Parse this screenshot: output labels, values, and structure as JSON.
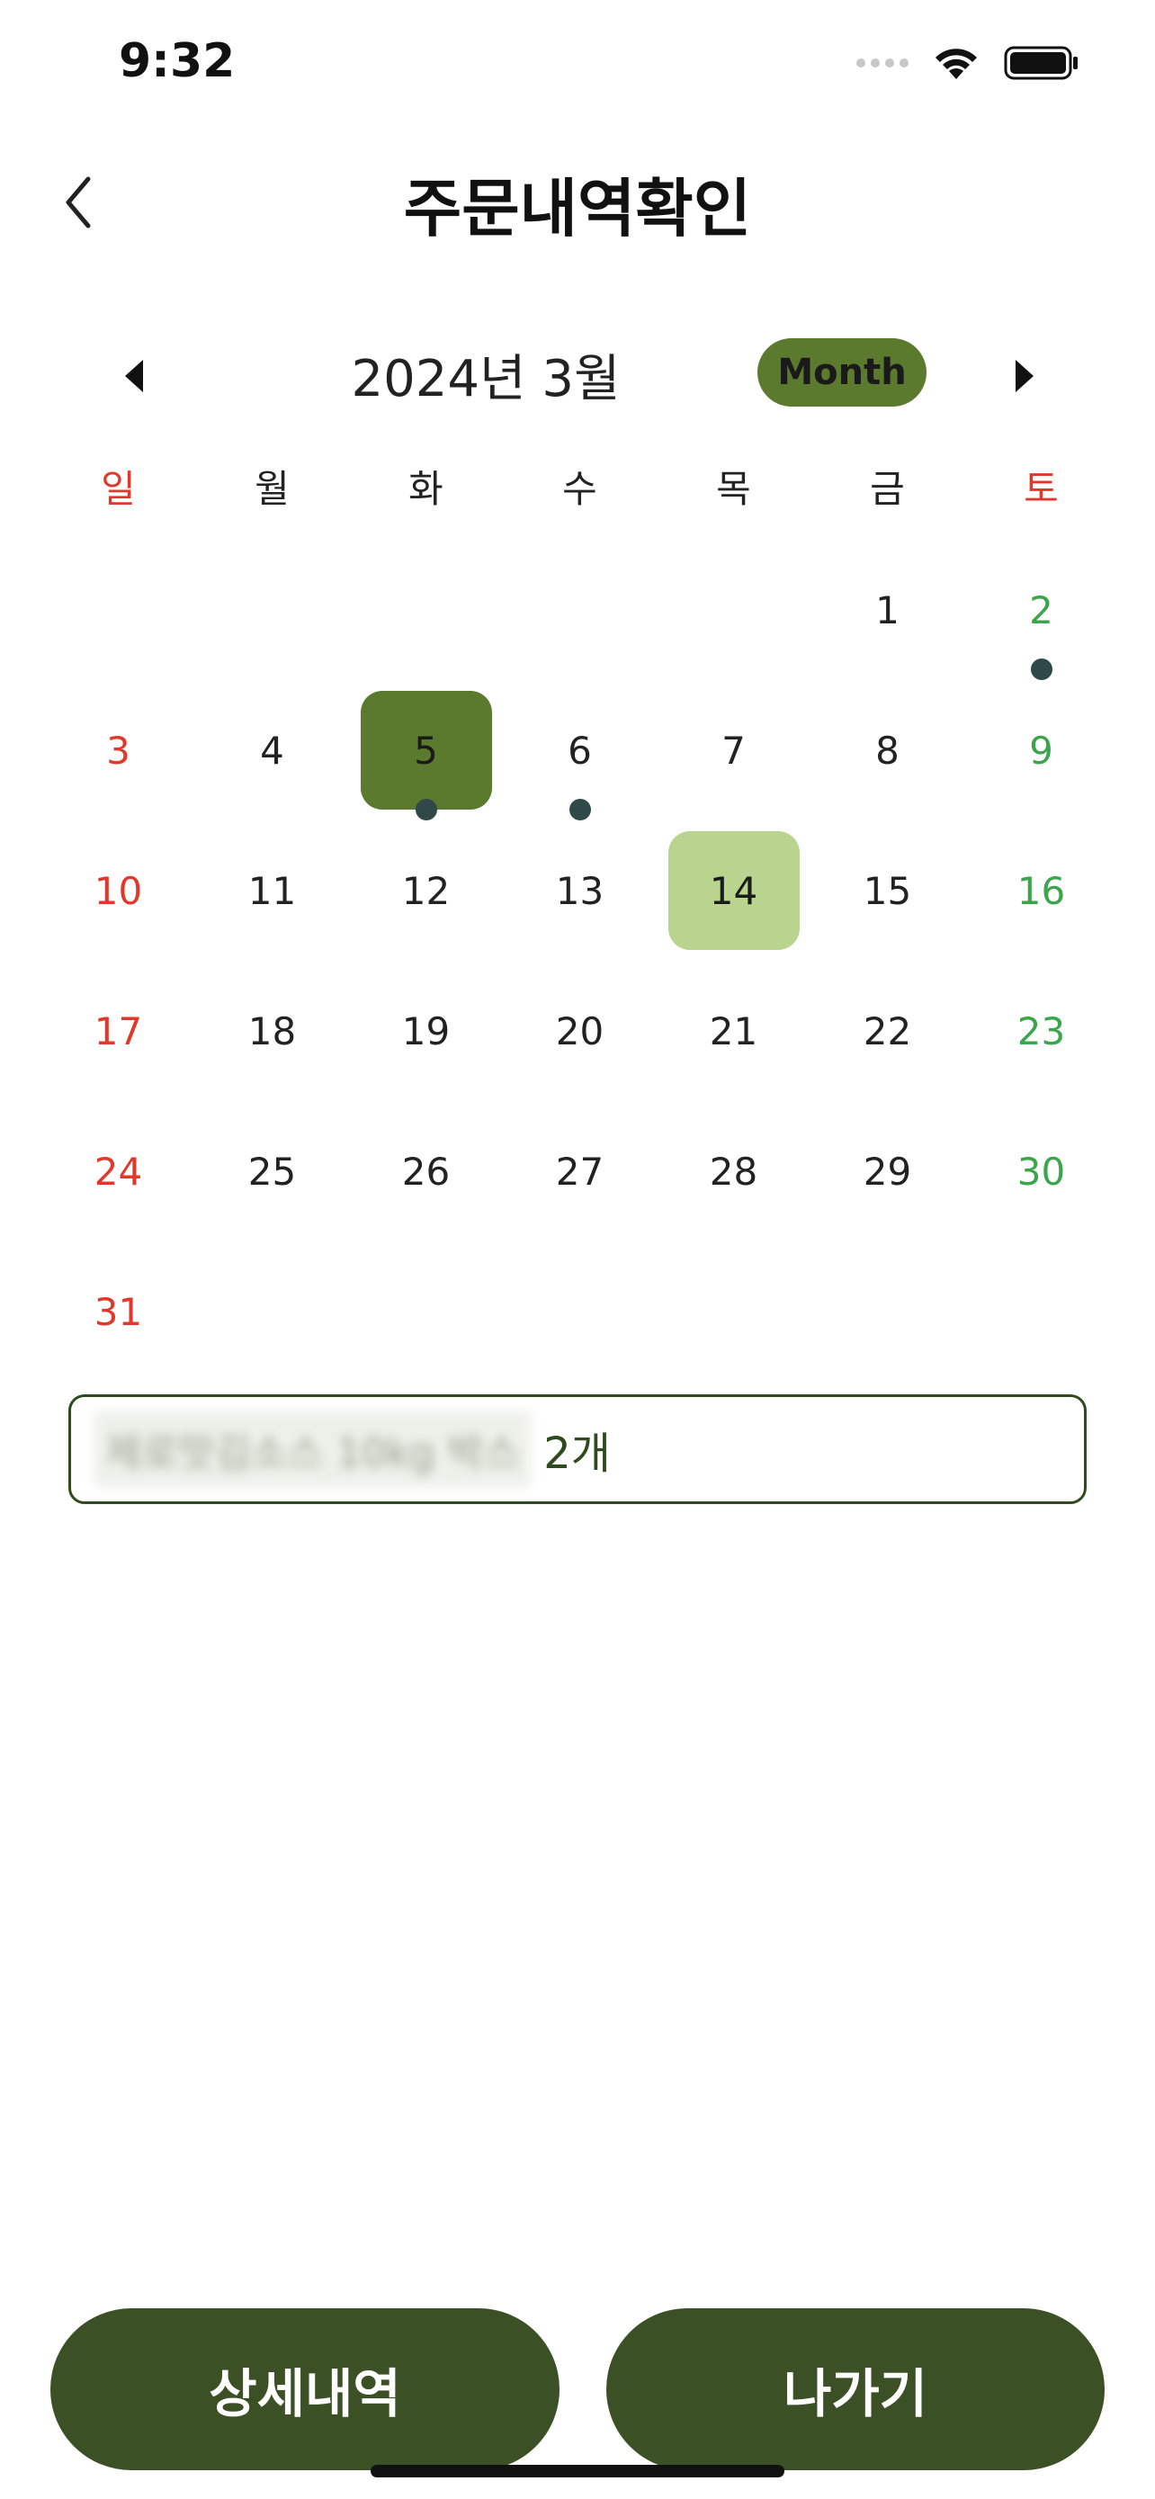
{
  "status_bar": {
    "time": "9:32"
  },
  "header": {
    "title": "주문내역확인"
  },
  "calendar": {
    "month_label": "2024년 3월",
    "view_toggle": "Month",
    "weekdays": [
      "일",
      "월",
      "화",
      "수",
      "목",
      "금",
      "토"
    ],
    "weeks": [
      [
        {
          "day": ""
        },
        {
          "day": ""
        },
        {
          "day": ""
        },
        {
          "day": ""
        },
        {
          "day": ""
        },
        {
          "day": "1"
        },
        {
          "day": "2",
          "has_order": true
        }
      ],
      [
        {
          "day": "3"
        },
        {
          "day": "4"
        },
        {
          "day": "5",
          "selected": true,
          "has_order": true
        },
        {
          "day": "6",
          "has_order": true
        },
        {
          "day": "7"
        },
        {
          "day": "8"
        },
        {
          "day": "9"
        }
      ],
      [
        {
          "day": "10"
        },
        {
          "day": "11"
        },
        {
          "day": "12"
        },
        {
          "day": "13"
        },
        {
          "day": "14",
          "today": true
        },
        {
          "day": "15"
        },
        {
          "day": "16"
        }
      ],
      [
        {
          "day": "17"
        },
        {
          "day": "18"
        },
        {
          "day": "19"
        },
        {
          "day": "20"
        },
        {
          "day": "21"
        },
        {
          "day": "22"
        },
        {
          "day": "23"
        }
      ],
      [
        {
          "day": "24"
        },
        {
          "day": "25"
        },
        {
          "day": "26"
        },
        {
          "day": "27"
        },
        {
          "day": "28"
        },
        {
          "day": "29"
        },
        {
          "day": "30"
        }
      ],
      [
        {
          "day": "31"
        },
        {
          "day": ""
        },
        {
          "day": ""
        },
        {
          "day": ""
        },
        {
          "day": ""
        },
        {
          "day": ""
        },
        {
          "day": ""
        }
      ]
    ]
  },
  "order": {
    "item_name": "제로맛김소스 10kg 박스",
    "quantity": "2개"
  },
  "buttons": {
    "detail": "상세내역",
    "exit": "나가기"
  },
  "colors": {
    "primary_dark": "#3b5024",
    "primary": "#5b7a2e",
    "today_bg": "#b8d48e",
    "sunday": "#e0392b",
    "saturday": "#3aa54a",
    "order_dot": "#304848"
  }
}
